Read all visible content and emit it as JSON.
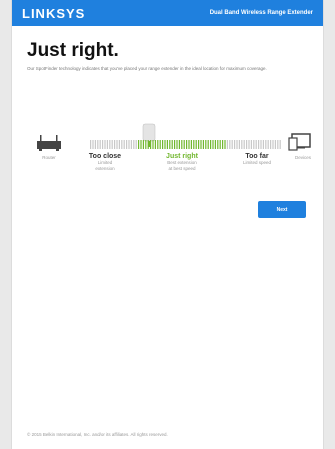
{
  "header": {
    "logo": "LINKSYS",
    "product": "Dual Band Wireless Range Extender"
  },
  "title": "Just right.",
  "description": "Our SpotFinder technology indicates that you've placed your range extender in the ideal location for maximum coverage.",
  "meter": {
    "router_label": "Router",
    "devices_label": "Devices",
    "zones": [
      {
        "title": "Too close",
        "sub1": "Limited",
        "sub2": "extension"
      },
      {
        "title": "Just right",
        "sub1": "Best extension",
        "sub2": "at best speed"
      },
      {
        "title": "Too far",
        "sub1": "Limited speed",
        "sub2": ""
      }
    ],
    "active_zone": "Just right",
    "colors": {
      "active": "#71b72e",
      "inactive": "#c8c8c8"
    }
  },
  "next_button": "Next",
  "footer": "© 2015 Belkin International, Inc. and/or its affiliates. All rights reserved."
}
